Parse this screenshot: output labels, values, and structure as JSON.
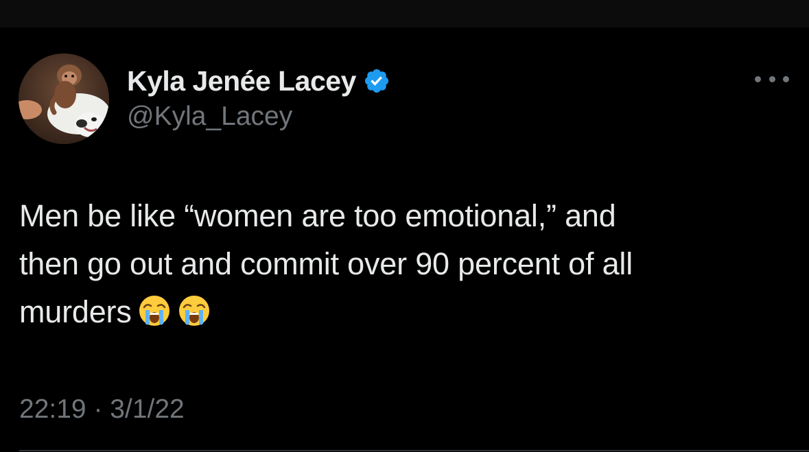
{
  "tweet": {
    "author": {
      "display_name": "Kyla Jenée Lacey",
      "handle": "@Kyla_Lacey",
      "verified": true,
      "verified_icon": "verified-badge-icon",
      "avatar_icon": "avatar-image"
    },
    "text_lines": [
      "Men be like “women are too emotional,” and",
      "then go out and commit over 90 percent of all",
      "murders"
    ],
    "emojis": [
      "loudly-crying-face-emoji",
      "loudly-crying-face-emoji"
    ],
    "time": "22:19",
    "separator": "·",
    "date": "3/1/22",
    "more_icon": "more-options-icon"
  },
  "colors": {
    "background": "#000000",
    "primary_text": "#e7e9ea",
    "secondary_text": "#71767b",
    "verified_blue": "#1d9bf0",
    "divider": "#2f3336"
  }
}
